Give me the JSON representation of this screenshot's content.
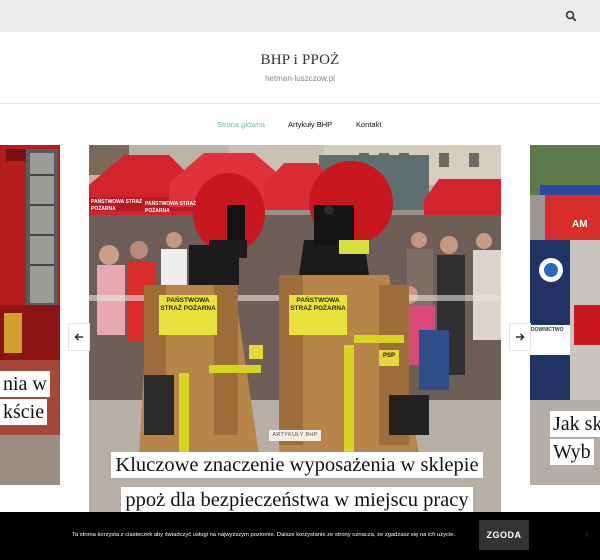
{
  "header": {
    "site_title": "BHP i PPOŻ",
    "site_tagline": "hetman-luszczow.pl"
  },
  "topbar": {
    "search_icon": "search-icon"
  },
  "nav": {
    "items": [
      {
        "label": "Strona główna",
        "active": true
      },
      {
        "label": "Artykuły BHP",
        "active": false
      },
      {
        "label": "Kontakt",
        "active": false
      }
    ]
  },
  "slider": {
    "main": {
      "category": "ARTYKUŁY BHP",
      "title_line1": "Kluczowe znaczenie wyposażenia w sklepie",
      "title_line2": "ppoż dla bezpieczeństwa w miejscu pracy",
      "image_text": {
        "tent_banner_1": "PAŃSTWOWA STRAŻ POŻARNA",
        "tent_banner_2": "PAŃSTWOWA STRAŻ POŻARNA",
        "jacket_left": "PAŃSTWOWA STRAŻ POŻARNA",
        "jacket_right": "PAŃSTWOWA STRAŻ POŻARNA",
        "patch": "PSP"
      }
    },
    "left_partial_title": [
      "nia w",
      "kście"
    ],
    "right_partial_title": [
      "Jak sk",
      "Wyb"
    ],
    "right_image_text": {
      "poster": "DOWNICTWO",
      "vehicle": "AM"
    },
    "prev_icon": "arrow-left-icon",
    "next_icon": "arrow-right-icon"
  },
  "cookie": {
    "text": "Ta strona korzysta z ciasteczek aby świadczyć usługi na najwyższym poziomie. Dalsze korzystanie ze strony oznacza, że zgadzasz się na ich użycie.",
    "accept_label": "ZGODA",
    "close_label": "×"
  },
  "colors": {
    "topbar_bg": "#ececec",
    "nav_active": "#7fb6b2",
    "cookie_bg": "#000000",
    "cookie_button_bg": "#333333",
    "tent_red": "#d3242d",
    "helmet_red": "#c8171e",
    "uniform_tan": "#b7844a",
    "reflective_yellow": "#e0dd2a"
  }
}
